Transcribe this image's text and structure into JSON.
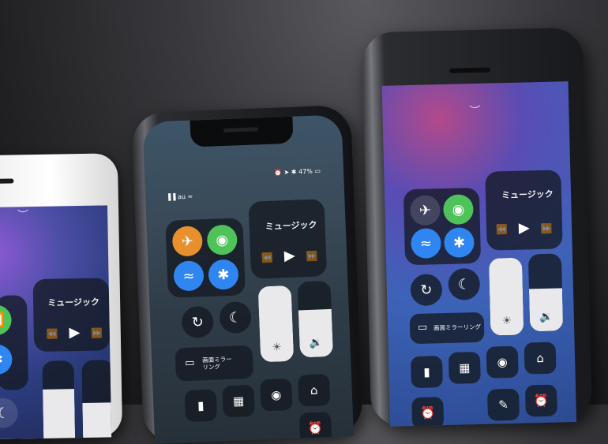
{
  "control_center": {
    "music_label": "ミュージック",
    "screen_mirroring_label": "画面ミラーリング",
    "screen_mirroring_label_wrapped": [
      "画面ミラー",
      "リング"
    ]
  },
  "status_bar": {
    "battery": "47%",
    "carrier": "au"
  },
  "icons": [
    "airplane-icon",
    "cellular-icon",
    "wifi-icon",
    "bluetooth-icon",
    "rotation-lock-icon",
    "moon-icon",
    "brightness-icon",
    "volume-icon",
    "airplay-icon",
    "flashlight-icon",
    "calculator-icon",
    "camera-icon",
    "home-icon",
    "alarm-icon",
    "play-icon",
    "rewind-icon",
    "fast-forward-icon",
    "chevron-icon"
  ],
  "colors": {
    "airplane_active": "#e88f2e",
    "cellular": "#4fc35a",
    "wifi": "#2f86f0",
    "bluetooth": "#2f86f0"
  }
}
